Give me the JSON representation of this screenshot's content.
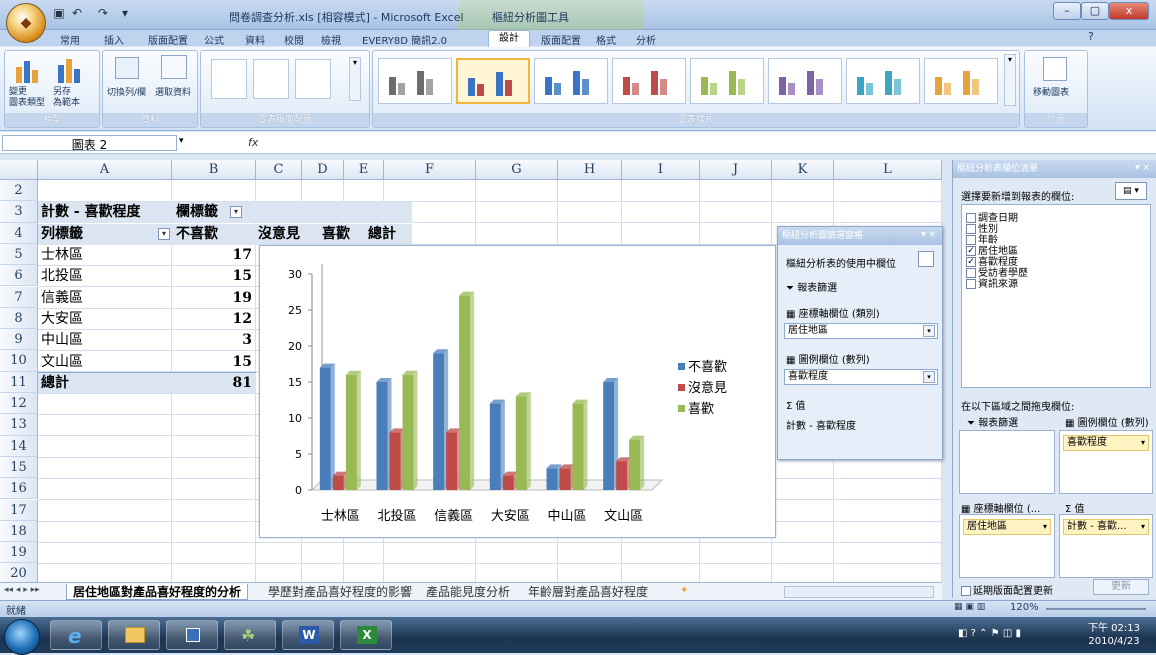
{
  "window": {
    "title": "問卷調查分析.xls [相容模式] - Microsoft Excel",
    "context_title": "樞紐分析圖工具",
    "min": "–",
    "max": "▢",
    "close": "x"
  },
  "tabs": [
    "常用",
    "插入",
    "版面配置",
    "公式",
    "資料",
    "校閱",
    "檢視",
    "EVERY8D 簡訊2.0",
    "設計",
    "版面配置",
    "格式",
    "分析"
  ],
  "ribbon": {
    "group_type_label": "類型",
    "btn_change_type": "變更\n圖表類型",
    "btn_save_template": "另存\n為範本",
    "group_data_label": "資料",
    "btn_switch": "切換列/欄",
    "btn_select_data": "選取資料",
    "group_layout_label": "圖表版面配置",
    "group_styles_label": "圖表樣式",
    "group_location_label": "位置",
    "btn_move_chart": "移動圖表"
  },
  "formula_bar": {
    "name_box": "圖表 2",
    "fx": "fx"
  },
  "columns": [
    "A",
    "B",
    "C",
    "D",
    "E",
    "F",
    "G",
    "H",
    "I",
    "J",
    "K",
    "L"
  ],
  "rows": [
    "2",
    "3",
    "4",
    "5",
    "6",
    "7",
    "8",
    "9",
    "10",
    "11",
    "12",
    "13",
    "14",
    "15",
    "16",
    "17",
    "18",
    "19",
    "20"
  ],
  "pivot": {
    "title": "計數 - 喜歡程度",
    "col_label": "欄標籤",
    "row_label": "列標籤",
    "headers": [
      "不喜歡",
      "沒意見",
      "喜歡",
      "總計"
    ],
    "rows": [
      {
        "label": "士林區",
        "value": "17"
      },
      {
        "label": "北投區",
        "value": "15"
      },
      {
        "label": "信義區",
        "value": "19"
      },
      {
        "label": "大安區",
        "value": "12"
      },
      {
        "label": "中山區",
        "value": "3"
      },
      {
        "label": "文山區",
        "value": "15"
      }
    ],
    "total_label": "總計",
    "total_value": "81"
  },
  "chart_data": {
    "type": "bar",
    "categories": [
      "士林區",
      "北投區",
      "信義區",
      "大安區",
      "中山區",
      "文山區"
    ],
    "series": [
      {
        "name": "不喜歡",
        "values": [
          17,
          15,
          19,
          12,
          3,
          15
        ],
        "color": "#4a7ebb"
      },
      {
        "name": "沒意見",
        "values": [
          2,
          8,
          8,
          2,
          3,
          4
        ],
        "color": "#be4b48"
      },
      {
        "name": "喜歡",
        "values": [
          16,
          16,
          27,
          13,
          12,
          7
        ],
        "color": "#98b954"
      }
    ],
    "yticks": [
      "0",
      "5",
      "10",
      "15",
      "20",
      "25",
      "30"
    ],
    "ylim": [
      0,
      30
    ],
    "grid": false,
    "legend": "right"
  },
  "filter_pane": {
    "title": "樞紐分析圖篩選窗格",
    "active_fields": "樞紐分析表的使用中欄位",
    "report_filter": "報表篩選",
    "axis_fields": "座標軸欄位 (類別)",
    "axis_value": "居住地區",
    "legend_fields": "圖例欄位 (數列)",
    "legend_value": "喜歡程度",
    "values": "值",
    "values_item": "計數 - 喜歡程度"
  },
  "field_list": {
    "title": "樞紐分析表欄位清單",
    "choose": "選擇要新增到報表的欄位:",
    "fields": [
      {
        "label": "調查日期",
        "checked": false
      },
      {
        "label": "性別",
        "checked": false
      },
      {
        "label": "年齡",
        "checked": false
      },
      {
        "label": "居住地區",
        "checked": true
      },
      {
        "label": "喜歡程度",
        "checked": true
      },
      {
        "label": "受訪者學歷",
        "checked": false
      },
      {
        "label": "資訊來源",
        "checked": false
      }
    ],
    "drag_hint": "在以下區域之間拖曳欄位:",
    "report_filter": "報表篩選",
    "legend_fields": "圖例欄位 (數列)",
    "legend_value": "喜歡程度",
    "axis_fields": "座標軸欄位 (...",
    "axis_value": "居住地區",
    "values": "值",
    "values_item": "計數 - 喜歡...",
    "defer": "延期版面配置更新",
    "update": "更新"
  },
  "sheet_tabs": [
    "居住地區對產品喜好程度的分析",
    "學歷對產品喜好程度的影響",
    "產品能見度分析",
    "年齡層對產品喜好程度"
  ],
  "status": {
    "ready": "就緒",
    "zoom": "120%"
  },
  "taskbar": {
    "time": "下午 02:13",
    "date": "2010/4/23"
  }
}
